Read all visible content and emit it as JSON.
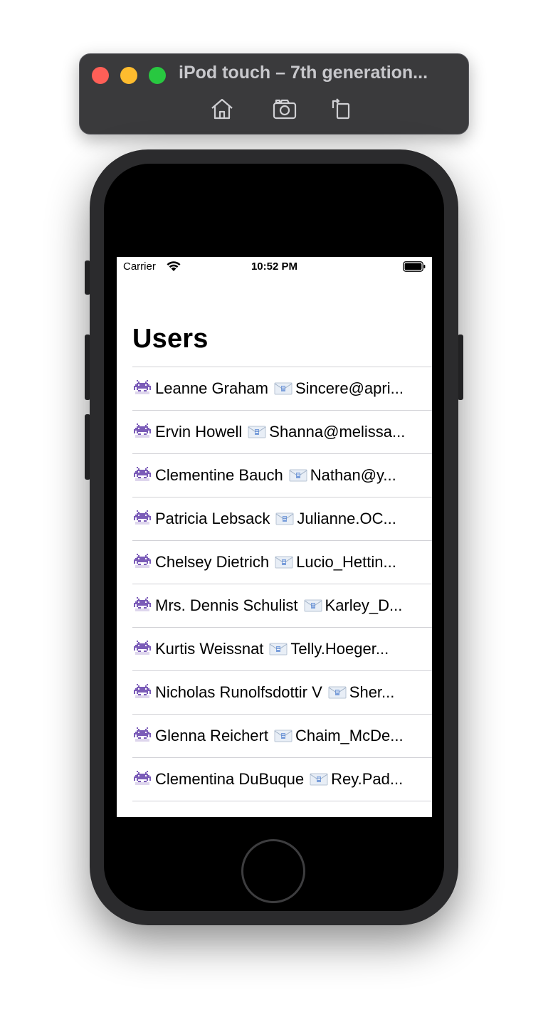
{
  "simulator": {
    "title": "iPod touch – 7th generation...",
    "toolbar_icons": [
      "home-icon",
      "screenshot-icon",
      "rotate-icon"
    ]
  },
  "status_bar": {
    "carrier": "Carrier",
    "time": "10:52 PM"
  },
  "screen": {
    "title": "Users",
    "users": [
      {
        "name": "Leanne Graham",
        "email": "Sincere@apri..."
      },
      {
        "name": "Ervin Howell",
        "email": "Shanna@melissa..."
      },
      {
        "name": "Clementine Bauch",
        "email": "Nathan@y..."
      },
      {
        "name": "Patricia Lebsack",
        "email": "Julianne.OC..."
      },
      {
        "name": "Chelsey Dietrich",
        "email": "Lucio_Hettin..."
      },
      {
        "name": "Mrs. Dennis Schulist",
        "email": "Karley_D..."
      },
      {
        "name": "Kurtis Weissnat",
        "email": "Telly.Hoeger..."
      },
      {
        "name": "Nicholas Runolfsdottir V",
        "email": "Sher..."
      },
      {
        "name": "Glenna Reichert",
        "email": "Chaim_McDe..."
      },
      {
        "name": "Clementina DuBuque",
        "email": "Rey.Pad..."
      }
    ],
    "row_icons": {
      "leading": "alien-monster-icon",
      "email": "mail-envelope-icon"
    }
  },
  "colors": {
    "toolbar_bg": "#3a3a3c",
    "close": "#ff5f57",
    "minimize": "#febc2e",
    "maximize": "#28c840",
    "invader": "#7b5cb8",
    "separator": "#d1d1d6"
  }
}
